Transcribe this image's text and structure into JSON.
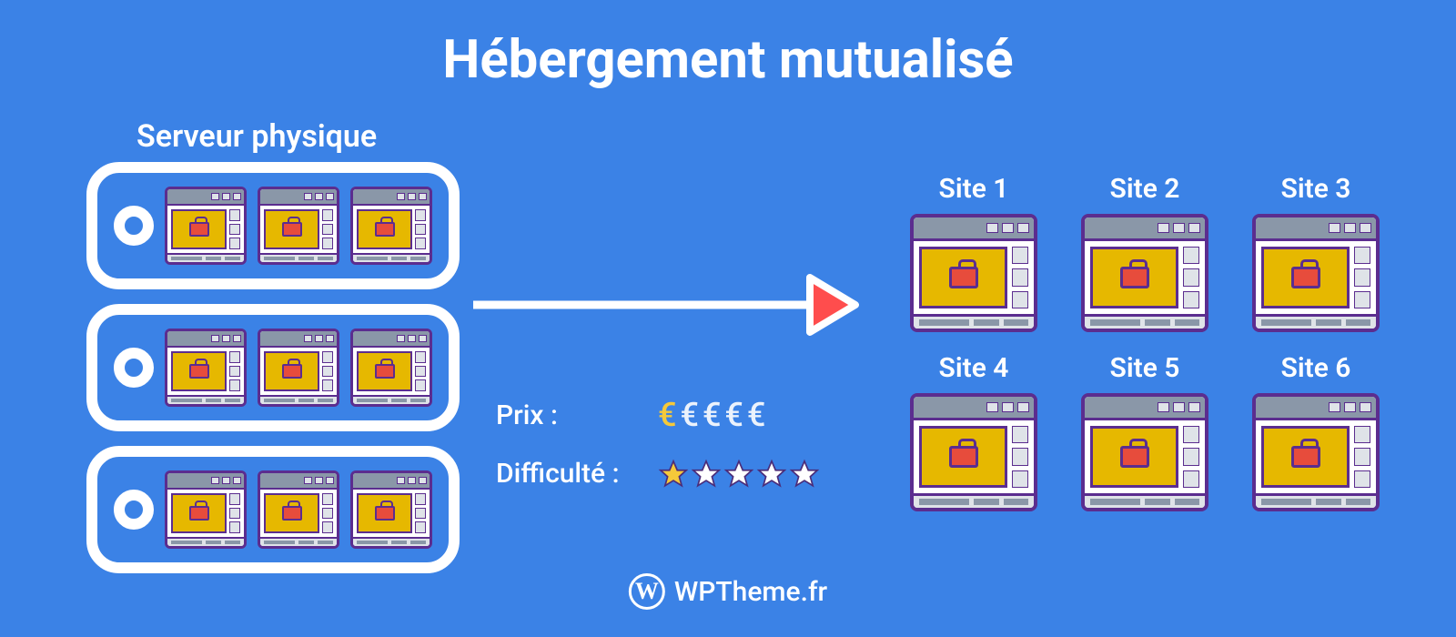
{
  "title": "Hébergement mutualisé",
  "server_label": "Serveur physique",
  "server": {
    "rack_units": 3,
    "windows_per_unit": 3
  },
  "metrics": {
    "price": {
      "label": "Prix :",
      "rating": 1,
      "max": 5
    },
    "difficulty": {
      "label": "Difficulté :",
      "rating": 1,
      "max": 5
    }
  },
  "sites": [
    {
      "label": "Site 1"
    },
    {
      "label": "Site 2"
    },
    {
      "label": "Site 3"
    },
    {
      "label": "Site 4"
    },
    {
      "label": "Site 5"
    },
    {
      "label": "Site 6"
    }
  ],
  "footer": {
    "brand": "WPTheme.fr"
  },
  "colors": {
    "bg": "#3b82e6",
    "accent_purple": "#5b2d8f",
    "accent_yellow": "#e6b800",
    "accent_red": "#e74c3c",
    "star_fill": "#f5c93a"
  }
}
